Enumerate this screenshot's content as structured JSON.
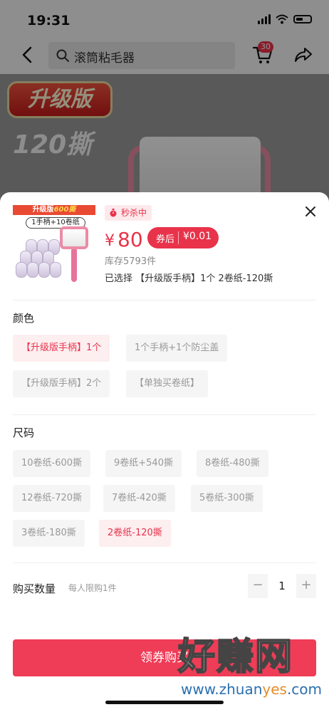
{
  "status_bar": {
    "time": "19:31"
  },
  "nav": {
    "search_placeholder": "滚筒粘毛器",
    "cart_badge": "30"
  },
  "hero": {
    "badge": "升级版",
    "count": "120撕"
  },
  "sheet": {
    "image_tag_prefix": "升级版",
    "image_tag_highlight": "600撕",
    "image_sub": "1手柄+10卷纸",
    "flash_label": "秒杀中",
    "price_currency": "¥",
    "price_value": "80",
    "coupon_label": "券后",
    "coupon_amount": "¥0.01",
    "stock": "库存5793件",
    "selected": "已选择 【升级版手柄】1个 2卷纸-120撕"
  },
  "color_section": {
    "title": "颜色",
    "options": [
      "【升级版手柄】1个",
      "1个手柄+1个防尘盖",
      "【升级版手柄】2个",
      "【单独买卷纸】"
    ],
    "selected_index": 0
  },
  "size_section": {
    "title": "尺码",
    "options": [
      "10卷纸-600撕",
      "9卷纸+540撕",
      "8卷纸-480撕",
      "12卷纸-720撕",
      "7卷纸-420撕",
      "5卷纸-300撕",
      "3卷纸-180撕",
      "2卷纸-120撕"
    ],
    "selected_index": 7
  },
  "quantity": {
    "label": "购买数量",
    "limit_note": "每人限购1件",
    "minus": "−",
    "value": "1",
    "plus": "+"
  },
  "buy_button": "领券购买",
  "watermark": {
    "main": "好赚网",
    "url_prefix": "www.zhuan",
    "url_highlight": "yes",
    "url_suffix": ".com"
  },
  "colors": {
    "accent": "#e8334a",
    "button": "#ef3c57"
  }
}
